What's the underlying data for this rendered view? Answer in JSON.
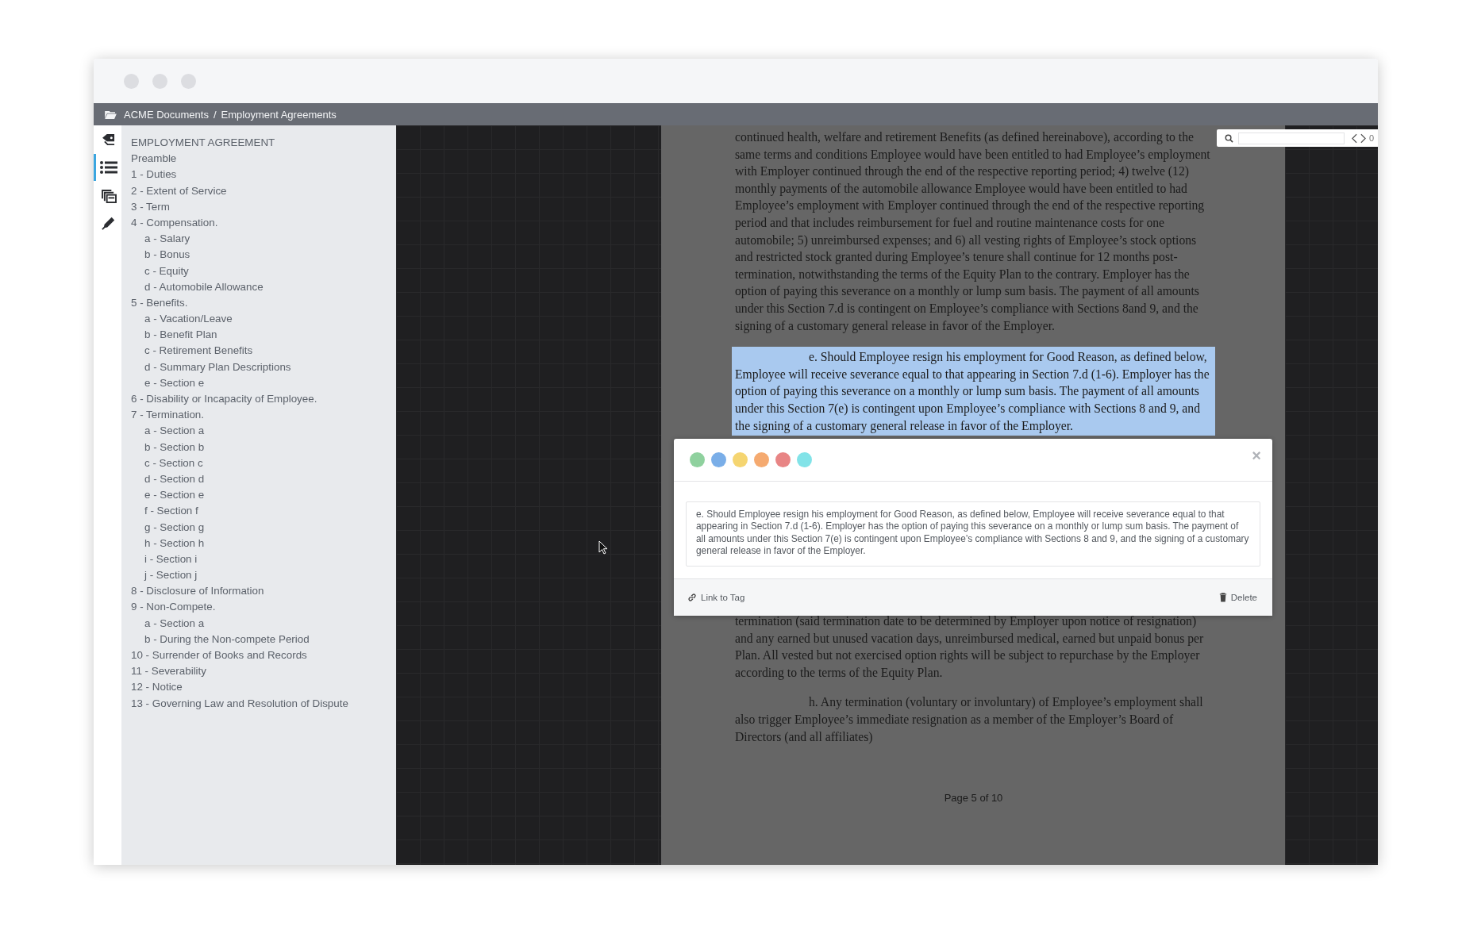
{
  "breadcrumb": [
    "ACME Documents",
    "Employment Agreements"
  ],
  "breadcrumb_separator": "/",
  "rail": [
    {
      "kind": "tags",
      "selected": false
    },
    {
      "kind": "outline",
      "selected": true
    },
    {
      "kind": "layers",
      "selected": false
    },
    {
      "kind": "pen",
      "selected": false
    }
  ],
  "outline": [
    {
      "label": "EMPLOYMENT AGREEMENT"
    },
    {
      "label": "Preamble"
    },
    {
      "label": "1 - Duties"
    },
    {
      "label": "2 - Extent of Service"
    },
    {
      "label": "3 - Term"
    },
    {
      "label": "4 - Compensation.",
      "children": [
        {
          "label": "a - Salary"
        },
        {
          "label": "b - Bonus"
        },
        {
          "label": "c - Equity"
        },
        {
          "label": "d - Automobile Allowance"
        }
      ]
    },
    {
      "label": "5 - Benefits.",
      "children": [
        {
          "label": "a - Vacation/Leave"
        },
        {
          "label": "b - Benefit Plan"
        },
        {
          "label": "c - Retirement Benefits"
        },
        {
          "label": "d - Summary Plan Descriptions"
        },
        {
          "label": "e - Section e"
        }
      ]
    },
    {
      "label": "6 - Disability or Incapacity of Employee."
    },
    {
      "label": "7 - Termination.",
      "children": [
        {
          "label": "a - Section a"
        },
        {
          "label": "b - Section b"
        },
        {
          "label": "c - Section c"
        },
        {
          "label": "d - Section d"
        },
        {
          "label": "e - Section e"
        },
        {
          "label": "f - Section f"
        },
        {
          "label": "g - Section g"
        },
        {
          "label": "h - Section h"
        },
        {
          "label": "i - Section i"
        },
        {
          "label": "j - Section j"
        }
      ]
    },
    {
      "label": "8 - Disclosure of Information"
    },
    {
      "label": "9 - Non-Compete.",
      "children": [
        {
          "label": "a - Section a"
        },
        {
          "label": "b - During the Non-compete Period"
        }
      ]
    },
    {
      "label": "10 - Surrender of Books and Records"
    },
    {
      "label": "11 - Severability"
    },
    {
      "label": "12 - Notice"
    },
    {
      "label": "13 - Governing Law and Resolution of Dispute"
    }
  ],
  "search": {
    "match_count": "0"
  },
  "document": {
    "paragraphs_above": [
      {
        "text": "continued health, welfare and retirement Benefits (as defined hereinabove), according to the same terms and conditions Employee would have been entitled to had Employee’s employment with Employer continued through the end of the respective reporting period; 4) twelve (12) monthly payments of the automobile allowance Employee would have been entitled to had Employee’s employment with Employer continued through the end of the respective reporting period and that includes reimbursement for fuel and routine maintenance costs for one automobile; 5) unreimbursed expenses; and 6) all vesting rights of Employee’s stock options and restricted stock granted during Employee’s tenure shall continue for 12 months post-termination, notwithstanding the terms of the Equity Plan to the contrary. Employer has the option of paying this severance on a monthly or lump sum basis. The payment of all amounts under this Section 7.d is contingent on Employee’s compliance with Sections 8and 9, and the signing of a customary general release in favor of the Employer.",
        "indented": false,
        "highlighted": false
      },
      {
        "text": "e. Should Employee resign his employment for Good Reason, as defined below, Employee will receive severance equal to that appearing in Section 7.d (1-6). Employer has the option of paying this severance on a monthly or lump sum basis. The payment of all amounts under this Section 7(e) is contingent upon Employee’s compliance with Sections 8 and 9, and the signing of a customary general release in favor of the Employer.",
        "indented": true,
        "highlighted": true
      }
    ],
    "paragraphs_below": [
      {
        "text": "termination (said termination date to be determined by Employer upon notice of resignation) and any earned but unused vacation days, unreimbursed medical, earned but unpaid bonus per Plan. All vested but not exercised option rights will be subject to repurchase by the Employer according to the terms of the Equity Plan.",
        "indented": false,
        "highlighted": false
      },
      {
        "text": "h. Any termination (voluntary or involuntary) of Employee’s employment shall also trigger Employee’s immediate resignation as a member of the Employer’s Board of Directors (and all affiliates)",
        "indented": true,
        "highlighted": false
      }
    ],
    "page_label": "Page 5 of 10"
  },
  "annotation": {
    "colors": [
      {
        "color": "#8fd19e"
      },
      {
        "color": "#7aaee8"
      },
      {
        "color": "#f5d571"
      },
      {
        "color": "#f5aa70"
      },
      {
        "color": "#e88585"
      },
      {
        "color": "#82e3e8"
      }
    ],
    "close": "×",
    "note": "e. Should Employee resign his employment for Good Reason, as defined below, Employee will receive severance equal to that appearing in Section 7.d (1-6). Employer has the option of paying this severance on a monthly or lump sum basis. The payment of all amounts under this Section 7(e) is contingent upon Employee’s compliance with Sections 8 and 9, and the signing of a customary general release in favor of the Employer.",
    "link_label": "Link to Tag",
    "delete_label": "Delete"
  }
}
